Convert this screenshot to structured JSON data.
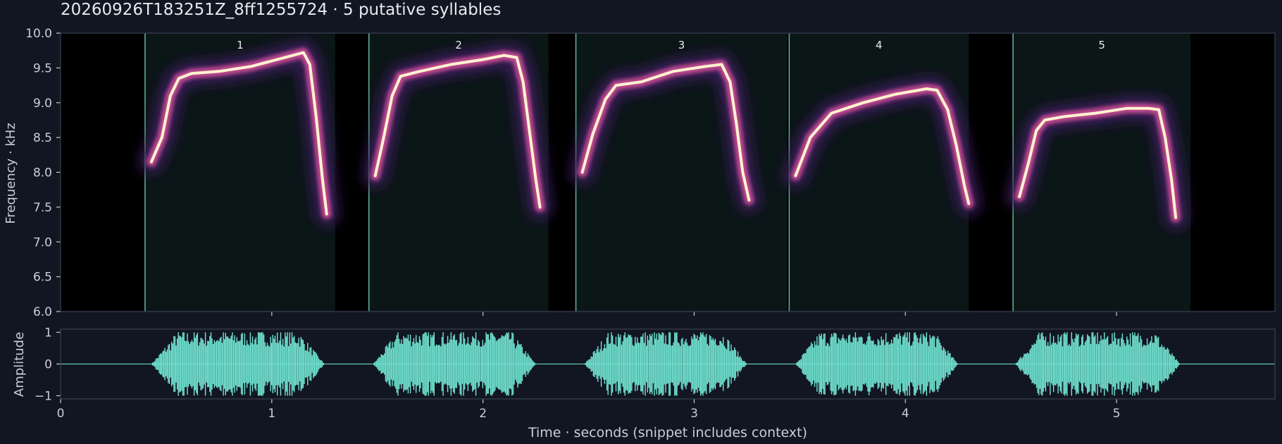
{
  "title": "20260926T183251Z_8ff1255724  ·  5 putative syllables",
  "colors": {
    "background": "#121622",
    "plot_bg": "#000000",
    "segment_fill": "#0b1616",
    "segment_line": "#5fae95",
    "waveform": "#72e6d3",
    "heat_low": "#3a1a5c",
    "heat_mid": "#c04a8f",
    "heat_high": "#fff3d0"
  },
  "chart_data": [
    {
      "type": "heatmap",
      "name": "spectrogram",
      "ylabel": "Frequency · kHz",
      "xlim": [
        0,
        5.75
      ],
      "ylim": [
        6.0,
        10.0
      ],
      "y_ticks": [
        "6.0",
        "6.5",
        "7.0",
        "7.5",
        "8.0",
        "8.5",
        "9.0",
        "9.5",
        "10.0"
      ],
      "x_ticks": [
        1,
        2,
        3,
        4,
        5
      ],
      "grid": false,
      "segments": [
        {
          "label": "1",
          "start": 0.4,
          "end": 1.3,
          "contour": [
            [
              0.43,
              8.15
            ],
            [
              0.48,
              8.5
            ],
            [
              0.52,
              9.1
            ],
            [
              0.56,
              9.35
            ],
            [
              0.62,
              9.42
            ],
            [
              0.75,
              9.45
            ],
            [
              0.9,
              9.52
            ],
            [
              1.0,
              9.6
            ],
            [
              1.1,
              9.68
            ],
            [
              1.15,
              9.72
            ],
            [
              1.18,
              9.55
            ],
            [
              1.21,
              8.8
            ],
            [
              1.24,
              7.9
            ],
            [
              1.26,
              7.4
            ]
          ]
        },
        {
          "label": "2",
          "start": 1.46,
          "end": 2.31,
          "contour": [
            [
              1.49,
              7.95
            ],
            [
              1.53,
              8.5
            ],
            [
              1.57,
              9.1
            ],
            [
              1.61,
              9.38
            ],
            [
              1.7,
              9.45
            ],
            [
              1.85,
              9.55
            ],
            [
              2.0,
              9.62
            ],
            [
              2.1,
              9.68
            ],
            [
              2.16,
              9.65
            ],
            [
              2.19,
              9.3
            ],
            [
              2.22,
              8.6
            ],
            [
              2.25,
              7.9
            ],
            [
              2.27,
              7.5
            ]
          ]
        },
        {
          "label": "3",
          "start": 2.44,
          "end": 3.44,
          "contour": [
            [
              2.47,
              8.0
            ],
            [
              2.52,
              8.55
            ],
            [
              2.58,
              9.05
            ],
            [
              2.63,
              9.25
            ],
            [
              2.75,
              9.3
            ],
            [
              2.9,
              9.45
            ],
            [
              3.05,
              9.52
            ],
            [
              3.13,
              9.55
            ],
            [
              3.17,
              9.3
            ],
            [
              3.2,
              8.7
            ],
            [
              3.23,
              8.0
            ],
            [
              3.26,
              7.6
            ]
          ]
        },
        {
          "label": "4",
          "start": 3.45,
          "end": 4.3,
          "contour": [
            [
              3.48,
              7.95
            ],
            [
              3.55,
              8.5
            ],
            [
              3.65,
              8.85
            ],
            [
              3.8,
              9.0
            ],
            [
              3.95,
              9.12
            ],
            [
              4.1,
              9.2
            ],
            [
              4.15,
              9.18
            ],
            [
              4.2,
              8.9
            ],
            [
              4.24,
              8.4
            ],
            [
              4.28,
              7.8
            ],
            [
              4.3,
              7.55
            ]
          ]
        },
        {
          "label": "5",
          "start": 4.51,
          "end": 5.35,
          "contour": [
            [
              4.54,
              7.65
            ],
            [
              4.58,
              8.1
            ],
            [
              4.62,
              8.6
            ],
            [
              4.66,
              8.75
            ],
            [
              4.75,
              8.8
            ],
            [
              4.9,
              8.85
            ],
            [
              5.05,
              8.92
            ],
            [
              5.15,
              8.92
            ],
            [
              5.2,
              8.9
            ],
            [
              5.23,
              8.5
            ],
            [
              5.26,
              7.9
            ],
            [
              5.28,
              7.35
            ]
          ]
        }
      ]
    },
    {
      "type": "area",
      "name": "waveform",
      "ylabel": "Amplitude",
      "xlabel": "Time · seconds (snippet includes context)",
      "xlim": [
        0,
        5.75
      ],
      "ylim": [
        -1.1,
        1.1
      ],
      "y_ticks": [
        "1",
        "0",
        "−1"
      ],
      "x_ticks": [
        "0",
        "1",
        "2",
        "3",
        "4",
        "5"
      ],
      "bursts": [
        {
          "start": 0.43,
          "end": 1.25
        },
        {
          "start": 1.48,
          "end": 2.25
        },
        {
          "start": 2.48,
          "end": 3.25
        },
        {
          "start": 3.48,
          "end": 4.25
        },
        {
          "start": 4.52,
          "end": 5.3
        }
      ]
    }
  ]
}
